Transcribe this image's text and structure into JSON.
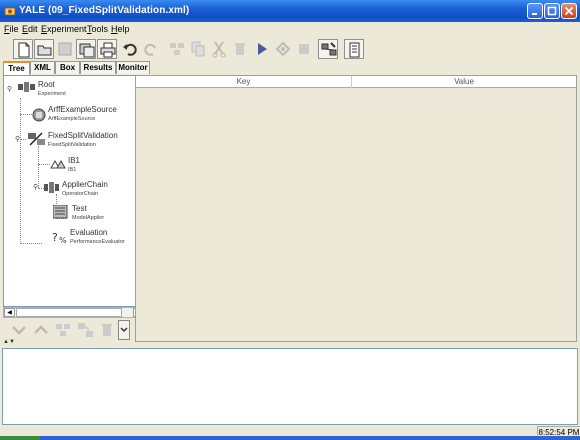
{
  "window": {
    "title": "YALE (09_FixedSplitValidation.xml)"
  },
  "menu": [
    "File",
    "Edit",
    "Experiment",
    "Tools",
    "Help"
  ],
  "toolbar": {
    "buttons": [
      "new-file-icon",
      "open-folder-icon",
      "save-icon",
      "save-as-icon",
      "print-icon",
      "undo-icon",
      "redo-icon",
      "disabled-operator-icon",
      "copy-icon",
      "cut-icon",
      "delete-icon",
      "run-icon",
      "pause-icon",
      "stop-icon",
      "validate-icon",
      "wizard-icon"
    ]
  },
  "tabs": [
    "Tree",
    "XML",
    "Box",
    "Results",
    "Monitor"
  ],
  "active_tab": "Tree",
  "tree": {
    "nodes": [
      {
        "title": "Root",
        "subtitle": "Experiment",
        "icon": "experiment-icon"
      },
      {
        "title": "ArffExampleSource",
        "subtitle": "ArffExampleSource",
        "icon": "database-icon"
      },
      {
        "title": "FixedSplitValidation",
        "subtitle": "FixedSplitValidation",
        "icon": "validation-icon"
      },
      {
        "title": "IB1",
        "subtitle": "IB1",
        "icon": "learner-icon"
      },
      {
        "title": "ApplierChain",
        "subtitle": "OperatorChain",
        "icon": "chain-icon"
      },
      {
        "title": "Test",
        "subtitle": "ModelApplier",
        "icon": "model-applier-icon"
      },
      {
        "title": "Evaluation",
        "subtitle": "PerformanceEvaluator",
        "icon": "evaluation-icon"
      }
    ]
  },
  "table": {
    "columns": [
      "Key",
      "Value"
    ]
  },
  "status": {
    "time": "8:52:54 PM"
  },
  "colors": {
    "titlebar": "#0f4ec4",
    "tab_highlight": "#e68b2c"
  }
}
